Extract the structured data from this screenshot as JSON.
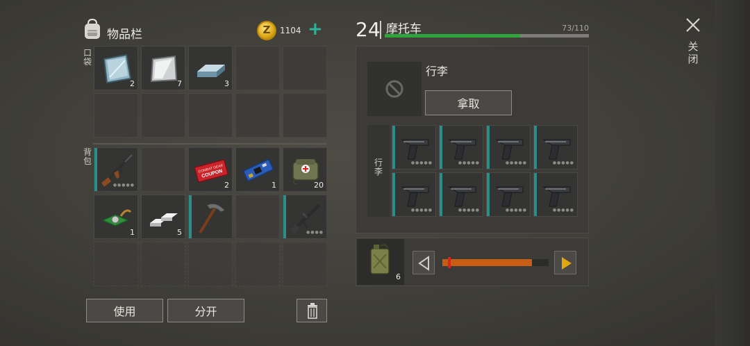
{
  "inventory": {
    "title": "物品栏",
    "coins": "1104",
    "coin_letter": "Z",
    "pocket_label": "口袋",
    "backpack_label": "背包",
    "pocket_items": [
      {
        "name": "steel-plate-icon",
        "qty": "2"
      },
      {
        "name": "sheet-metal-icon",
        "qty": "7"
      },
      {
        "name": "metal-ingot-icon",
        "qty": "3"
      }
    ],
    "backpack_items": [
      {
        "name": "assault-rifle-icon",
        "qty": ""
      },
      {
        "name": "combat-gear-coupon-icon",
        "qty": "2",
        "text": "COMBAT GEAR COUPON"
      },
      {
        "name": "circuit-board-icon",
        "qty": "1"
      },
      {
        "name": "medkit-bag-icon",
        "qty": "20"
      },
      {
        "name": "electronic-part-icon",
        "qty": "1"
      },
      {
        "name": "silver-bars-icon",
        "qty": "5"
      },
      {
        "name": "pickaxe-icon",
        "qty": ""
      },
      {
        "name": "rifle-icon",
        "qty": ""
      }
    ],
    "use_label": "使用",
    "split_label": "分开"
  },
  "vehicle": {
    "level": "24",
    "name": "摩托车",
    "capacity_text": "73/110",
    "capacity_fraction": 0.664,
    "luggage_label": "行李",
    "take_label": "拿取",
    "luggage_side_label": "行李",
    "luggage_items": [
      "pistol-icon",
      "pistol-icon",
      "pistol-icon",
      "pistol-icon",
      "pistol-icon",
      "pistol-icon",
      "pistol-icon",
      "pistol-icon"
    ],
    "fuel_qty": "6",
    "fuel_fraction": 0.84
  },
  "close_label": "关闭",
  "colors": {
    "accent_teal": "#2a8f8a",
    "capacity_green": "#2fa43a",
    "slider_orange": "#c75e14",
    "arrow_yellow": "#e0a80e"
  }
}
